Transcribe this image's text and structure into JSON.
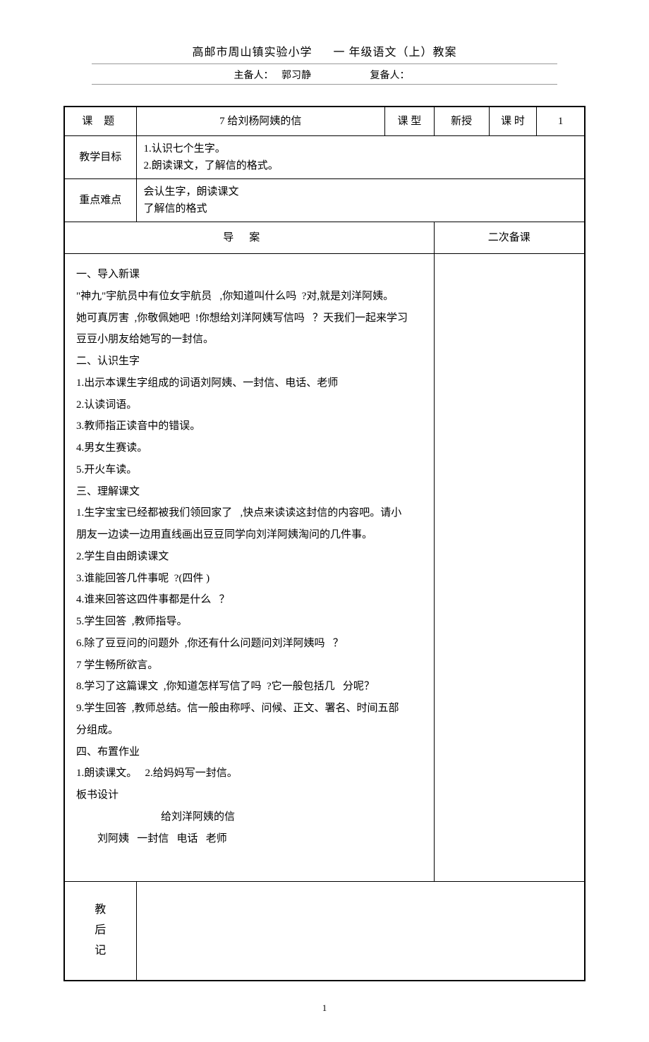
{
  "header": {
    "school": "高邮市周山镇实验小学",
    "course": "一  年级语文（上）教案",
    "preparer_label": "主备人：",
    "preparer_name": "郭习静",
    "copreparer_label": "复备人："
  },
  "row_title": {
    "label": "课    题",
    "value": "7 给刘杨阿姨的信",
    "type_label": "课  型",
    "type_value": "新授",
    "period_label": "课  时",
    "period_value": "1"
  },
  "row_goal": {
    "label": "教学目标",
    "line1": "1.认识七个生字。",
    "line2": "2.朗读课文，了解信的格式。"
  },
  "row_keypoint": {
    "label": "重点难点",
    "line1": "会认生字，朗读课文",
    "line2": "了解信的格式"
  },
  "row_daoan": {
    "left": "导案",
    "right": "二次备课"
  },
  "body": {
    "p01": "一、导入新课",
    "p02": "\"神九\"宇航员中有位女宇航员   ,你知道叫什么吗  ?对,就是刘洋阿姨。",
    "p03": "她可真厉害  ,你敬佩她吧  !你想给刘洋阿姨写信吗   ？天我们一起来学习",
    "p04": "豆豆小朋友给她写的一封信。",
    "p05": "二、认识生字",
    "p06": "1.出示本课生字组成的词语刘阿姨、一封信、电话、老师",
    "p07": "2.认读词语。",
    "p08": "3.教师指正读音中的错误。",
    "p09": "4.男女生赛读。",
    "p10": "5.开火车读。",
    "p11": "三、理解课文",
    "p12": "1.生字宝宝已经都被我们领回家了   ,快点来读读这封信的内容吧。请小",
    "p13": "朋友一边读一边用直线画出豆豆同学向刘洋阿姨淘问的几件事。",
    "p14": "2.学生自由朗读课文",
    "p15": "3.谁能回答几件事呢  ?(四件 )",
    "p16": "4.谁来回答这四件事都是什么   ？",
    "p17": "5.学生回答  ,教师指导。",
    "p18": "6.除了豆豆问的问题外  ,你还有什么问题问刘洋阿姨吗   ？",
    "p19": "7 学生畅所欲言。",
    "p20": "8.学习了这篇课文  ,你知道怎样写信了吗  ?它一般包括几   分呢？",
    "p21": "9.学生回答  ,教师总结。信一般由称呼、问候、正文、署名、时间五部",
    "p22": "分组成。",
    "p23": "四、布置作业",
    "p24": "1.朗读课文。   2.给妈妈写一封信。",
    "p25": "板书设计",
    "p26": "给刘洋阿姨的信",
    "p27": "刘阿姨   一封信   电话   老师"
  },
  "footer": {
    "label1": "教",
    "label2": "后",
    "label3": "记"
  },
  "page_number": "1"
}
